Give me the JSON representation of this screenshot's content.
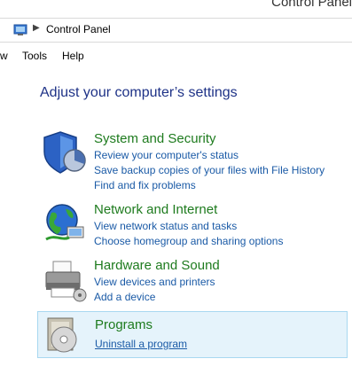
{
  "window": {
    "title": "Control Panel"
  },
  "address": {
    "path": "Control Panel"
  },
  "menu": {
    "items": [
      "w",
      "Tools",
      "Help"
    ]
  },
  "heading": "Adjust your computer’s settings",
  "categories": [
    {
      "title": "System and Security",
      "icon": "shield-icon",
      "links": [
        "Review your computer's status",
        "Save backup copies of your files with File History",
        "Find and fix problems"
      ]
    },
    {
      "title": "Network and Internet",
      "icon": "globe-network-icon",
      "links": [
        "View network status and tasks",
        "Choose homegroup and sharing options"
      ]
    },
    {
      "title": "Hardware and Sound",
      "icon": "printer-icon",
      "links": [
        "View devices and printers",
        "Add a device"
      ]
    },
    {
      "title": "Programs",
      "icon": "programs-disc-icon",
      "links": [
        "Uninstall a program"
      ]
    }
  ]
}
